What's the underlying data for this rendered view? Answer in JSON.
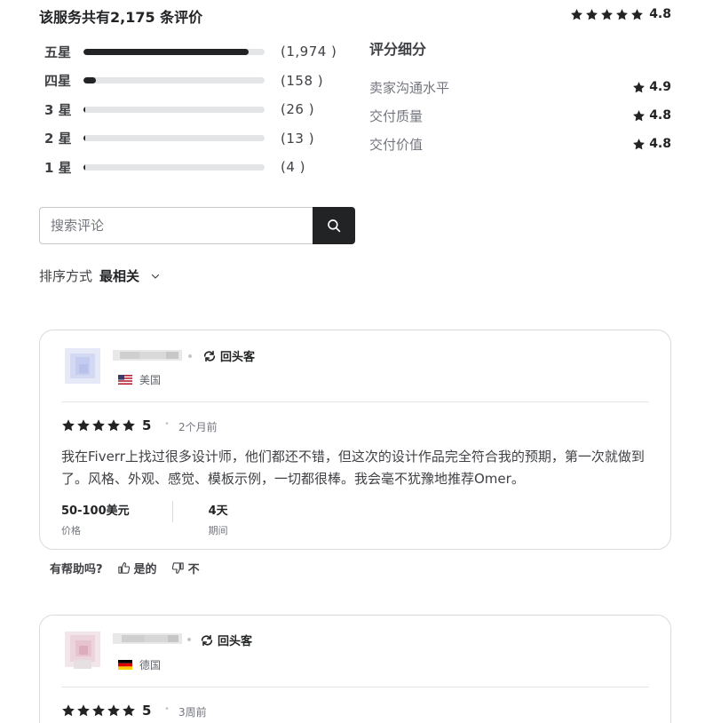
{
  "summary": {
    "title": "该服务共有2,175 条评价",
    "overall": "4.8"
  },
  "histogram": [
    {
      "label": "五星",
      "count": "(1,974 )",
      "fill": 0.91
    },
    {
      "label": "四星",
      "count": "(158 )",
      "fill": 0.07
    },
    {
      "label": "3 星",
      "count": "(26 )",
      "fill": 0.012
    },
    {
      "label": "2 星",
      "count": "(13 )",
      "fill": 0.006
    },
    {
      "label": "1 星",
      "count": "(4 )",
      "fill": 0.003
    }
  ],
  "breakdown": {
    "title": "评分细分",
    "rows": [
      {
        "label": "卖家沟通水平",
        "value": "4.9"
      },
      {
        "label": "交付质量",
        "value": "4.8"
      },
      {
        "label": "交付价值",
        "value": "4.8"
      }
    ]
  },
  "search": {
    "placeholder": "搜索评论",
    "icon": "search-icon"
  },
  "sort": {
    "label": "排序方式",
    "value": "最相关"
  },
  "reviews": [
    {
      "repeat_label": "回头客",
      "country": "美国",
      "rating": "5",
      "time": "2个月前",
      "text": "我在Fiverr上找过很多设计师，他们都还不错，但这次的设计作品完全符合我的预期，第一次就做到了。风格、外观、感觉、模板示例，一切都很棒。我会毫不犹豫地推荐Omer。",
      "price": "50-100美元",
      "price_label": "价格",
      "duration": "4天",
      "duration_label": "期间"
    },
    {
      "repeat_label": "回头客",
      "country": "德国",
      "rating": "5",
      "time": "3周前"
    }
  ],
  "helpful": {
    "question": "有帮助吗?",
    "yes": "是的",
    "no": "不"
  },
  "colors": {
    "accent": "#222325",
    "muted": "#74767e",
    "track": "#e4e5e7"
  }
}
